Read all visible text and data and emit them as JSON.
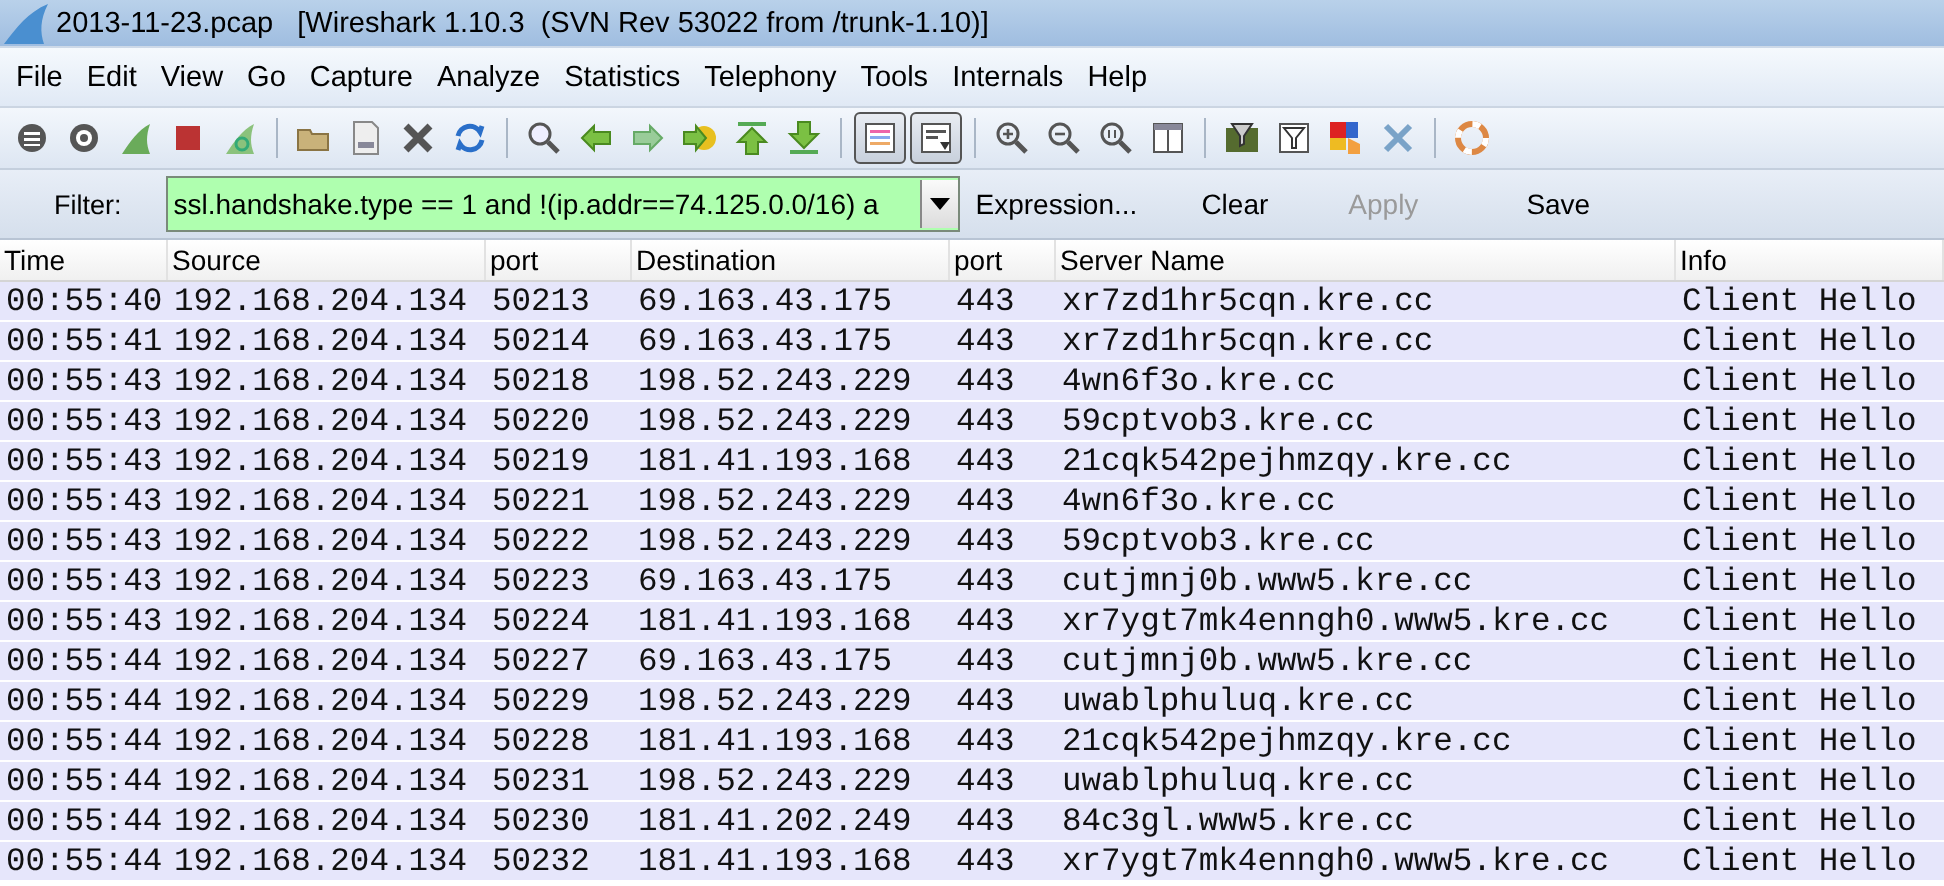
{
  "window": {
    "title": "2013-11-23.pcap   [Wireshark 1.10.3  (SVN Rev 53022 from /trunk-1.10)]"
  },
  "menu": [
    "File",
    "Edit",
    "View",
    "Go",
    "Capture",
    "Analyze",
    "Statistics",
    "Telephony",
    "Tools",
    "Internals",
    "Help"
  ],
  "toolbar": [
    [
      {
        "kind": "interfaces",
        "on": false
      },
      {
        "kind": "options",
        "on": false
      },
      {
        "kind": "start",
        "on": false
      },
      {
        "kind": "stop",
        "on": false
      },
      {
        "kind": "restart",
        "on": false
      }
    ],
    [
      {
        "kind": "open",
        "on": false
      },
      {
        "kind": "save",
        "on": false
      },
      {
        "kind": "close",
        "on": false
      },
      {
        "kind": "reload",
        "on": false
      }
    ],
    [
      {
        "kind": "find",
        "on": false
      },
      {
        "kind": "back",
        "on": false
      },
      {
        "kind": "forward",
        "on": false
      },
      {
        "kind": "goto",
        "on": false
      },
      {
        "kind": "first",
        "on": false
      },
      {
        "kind": "last",
        "on": false
      }
    ],
    [
      {
        "kind": "colorize",
        "on": true
      },
      {
        "kind": "autoscroll",
        "on": true
      }
    ],
    [
      {
        "kind": "zoomin",
        "on": false
      },
      {
        "kind": "zoomout",
        "on": false
      },
      {
        "kind": "zoomnormal",
        "on": false
      },
      {
        "kind": "resize",
        "on": false
      }
    ],
    [
      {
        "kind": "capfilter",
        "on": false
      },
      {
        "kind": "dispfilter",
        "on": false
      },
      {
        "kind": "coloring",
        "on": false
      },
      {
        "kind": "prefs",
        "on": false
      }
    ],
    [
      {
        "kind": "help",
        "on": false
      }
    ]
  ],
  "filter": {
    "label": "Filter:",
    "value": "ssl.handshake.type == 1 and !(ip.addr==74.125.0.0/16) a",
    "buttons": [
      {
        "label": "Expression...",
        "disabled": false
      },
      {
        "label": "Clear",
        "disabled": false
      },
      {
        "label": "Apply",
        "disabled": true
      },
      {
        "label": "Save",
        "disabled": false
      }
    ]
  },
  "table": {
    "columns": [
      "Time",
      "Source",
      "port",
      "Destination",
      "port",
      "Server Name",
      "Info"
    ],
    "rows": [
      [
        "00:55:40",
        "192.168.204.134",
        "50213",
        "69.163.43.175",
        "443",
        "xr7zd1hr5cqn.kre.cc",
        "Client Hello"
      ],
      [
        "00:55:41",
        "192.168.204.134",
        "50214",
        "69.163.43.175",
        "443",
        "xr7zd1hr5cqn.kre.cc",
        "Client Hello"
      ],
      [
        "00:55:43",
        "192.168.204.134",
        "50218",
        "198.52.243.229",
        "443",
        "4wn6f3o.kre.cc",
        "Client Hello"
      ],
      [
        "00:55:43",
        "192.168.204.134",
        "50220",
        "198.52.243.229",
        "443",
        "59cptvob3.kre.cc",
        "Client Hello"
      ],
      [
        "00:55:43",
        "192.168.204.134",
        "50219",
        "181.41.193.168",
        "443",
        "21cqk542pejhmzqy.kre.cc",
        "Client Hello"
      ],
      [
        "00:55:43",
        "192.168.204.134",
        "50221",
        "198.52.243.229",
        "443",
        "4wn6f3o.kre.cc",
        "Client Hello"
      ],
      [
        "00:55:43",
        "192.168.204.134",
        "50222",
        "198.52.243.229",
        "443",
        "59cptvob3.kre.cc",
        "Client Hello"
      ],
      [
        "00:55:43",
        "192.168.204.134",
        "50223",
        "69.163.43.175",
        "443",
        "cutjmnj0b.www5.kre.cc",
        "Client Hello"
      ],
      [
        "00:55:43",
        "192.168.204.134",
        "50224",
        "181.41.193.168",
        "443",
        "xr7ygt7mk4enngh0.www5.kre.cc",
        "Client Hello"
      ],
      [
        "00:55:44",
        "192.168.204.134",
        "50227",
        "69.163.43.175",
        "443",
        "cutjmnj0b.www5.kre.cc",
        "Client Hello"
      ],
      [
        "00:55:44",
        "192.168.204.134",
        "50229",
        "198.52.243.229",
        "443",
        "uwablphuluq.kre.cc",
        "Client Hello"
      ],
      [
        "00:55:44",
        "192.168.204.134",
        "50228",
        "181.41.193.168",
        "443",
        "21cqk542pejhmzqy.kre.cc",
        "Client Hello"
      ],
      [
        "00:55:44",
        "192.168.204.134",
        "50231",
        "198.52.243.229",
        "443",
        "uwablphuluq.kre.cc",
        "Client Hello"
      ],
      [
        "00:55:44",
        "192.168.204.134",
        "50230",
        "181.41.202.249",
        "443",
        "84c3gl.www5.kre.cc",
        "Client Hello"
      ],
      [
        "00:55:44",
        "192.168.204.134",
        "50232",
        "181.41.193.168",
        "443",
        "xr7ygt7mk4enngh0.www5.kre.cc",
        "Client Hello"
      ]
    ]
  }
}
